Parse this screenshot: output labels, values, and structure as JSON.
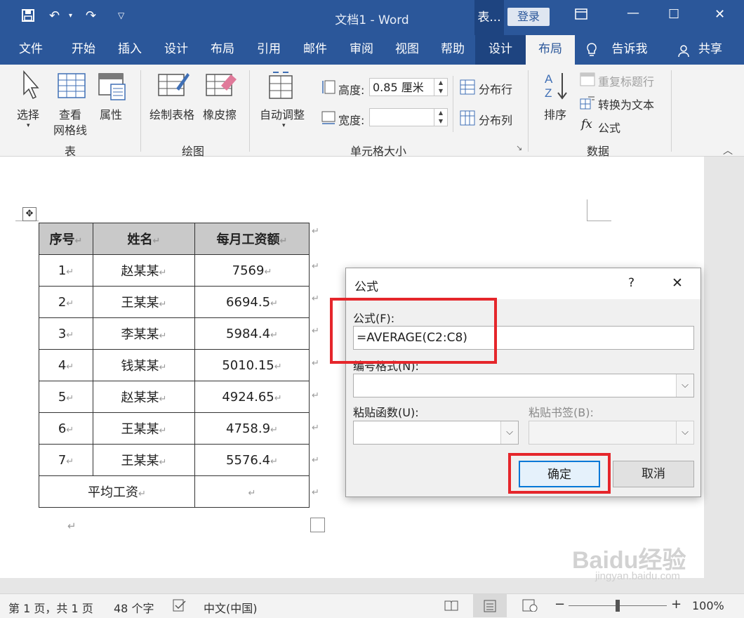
{
  "titlebar": {
    "doc_title": "文档1  -  Word",
    "context_label": "表...",
    "login": "登录"
  },
  "menu": [
    "文件",
    "开始",
    "插入",
    "设计",
    "布局",
    "引用",
    "邮件",
    "审阅",
    "视图",
    "帮助",
    "设计",
    "布局"
  ],
  "tell_me": "告诉我",
  "share": "共享",
  "ribbon": {
    "select": "选择",
    "view_gridlines_1": "查看",
    "view_gridlines_2": "网格线",
    "properties": "属性",
    "draw_table": "绘制表格",
    "eraser": "橡皮擦",
    "autofit": "自动调整",
    "height_label": "高度:",
    "height_value": "0.85 厘米",
    "width_label": "宽度:",
    "width_value": "",
    "distribute_rows": "分布行",
    "distribute_cols": "分布列",
    "sort": "排序",
    "repeat_header": "重复标题行",
    "convert_to_text": "转换为文本",
    "formula": "公式",
    "groups": {
      "table": "表",
      "draw": "绘图",
      "cell_size": "单元格大小",
      "data": "数据"
    }
  },
  "table": {
    "headers": [
      "序号",
      "姓名",
      "每月工资额"
    ],
    "rows": [
      [
        "1",
        "赵某某",
        "7569"
      ],
      [
        "2",
        "王某某",
        "6694.5"
      ],
      [
        "3",
        "李某某",
        "5984.4"
      ],
      [
        "4",
        "钱某某",
        "5010.15"
      ],
      [
        "5",
        "赵某某",
        "4924.65"
      ],
      [
        "6",
        "王某某",
        "4758.9"
      ],
      [
        "7",
        "王某某",
        "5576.4"
      ]
    ],
    "footer_label": "平均工资",
    "footer_value": ""
  },
  "dialog": {
    "title": "公式",
    "help": "?",
    "close": "✕",
    "formula_label": "公式(F):",
    "formula_value": "=AVERAGE(C2:C8)",
    "number_format_label": "编号格式(N):",
    "number_format_value": "",
    "paste_function_label": "粘贴函数(U):",
    "paste_bookmark_label": "粘贴书签(B):",
    "ok": "确定",
    "cancel": "取消"
  },
  "status": {
    "page": "第 1 页，共 1 页",
    "words": "48 个字",
    "language": "中文(中国)",
    "zoom": "100%",
    "zoom_level": 1.0
  },
  "watermark": {
    "brand": "Baidu经验",
    "url": "jingyan.baidu.com"
  },
  "colors": {
    "word_blue": "#2b579a",
    "highlight_red": "#e5262b",
    "header_gray": "#c9c9c9"
  }
}
